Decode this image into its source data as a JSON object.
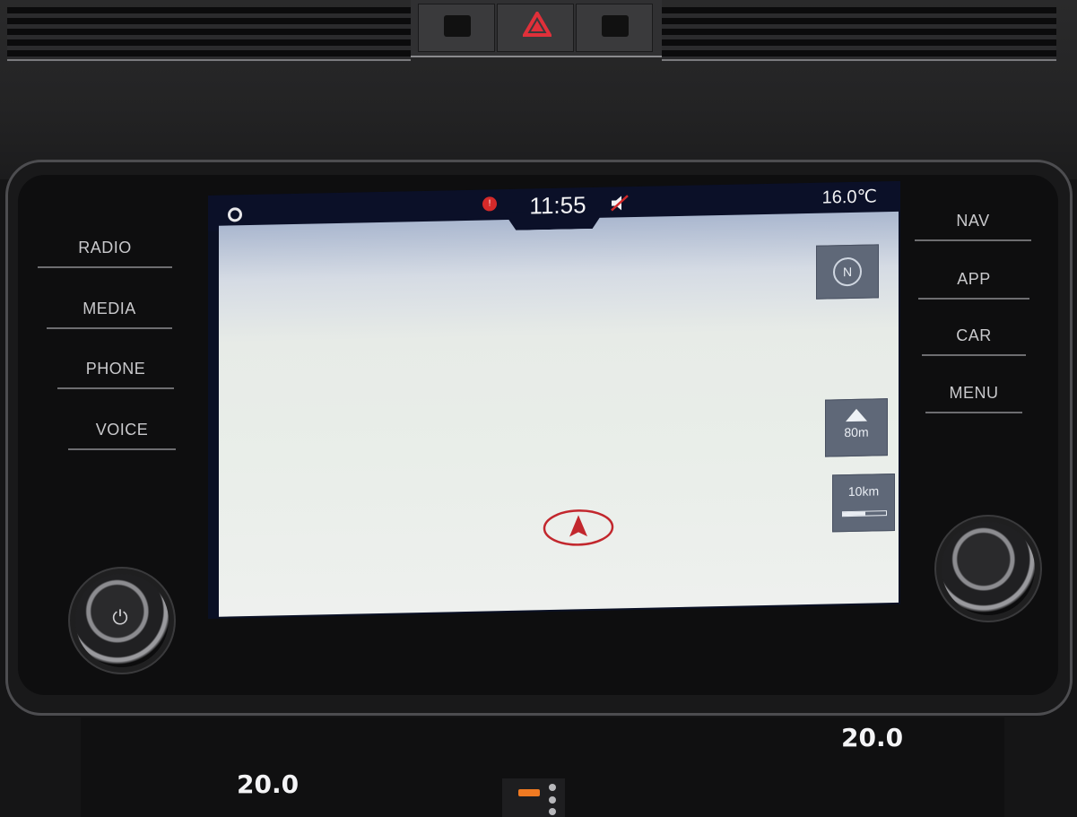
{
  "status_bar": {
    "time": "11:55",
    "outside_temperature": "16.0℃"
  },
  "left_buttons": [
    "RADIO",
    "MEDIA",
    "PHONE",
    "VOICE"
  ],
  "right_buttons": [
    "NAV",
    "APP",
    "CAR",
    "MENU"
  ],
  "map_controls": {
    "compass_label": "N",
    "altitude": "80m",
    "scale": "10km"
  },
  "climate": {
    "left_temp": "20.0",
    "right_temp": "20.0"
  },
  "colors": {
    "status_bar_bg": "#0b1028",
    "position_marker": "#c2272d",
    "hazard": "#e0303a",
    "map_button_bg": "#5f6878"
  },
  "icons": [
    "hazard-icon",
    "nav-status-icon",
    "alert-icon",
    "mute-icon",
    "compass-icon",
    "mountain-icon",
    "power-icon",
    "position-arrow-icon"
  ]
}
